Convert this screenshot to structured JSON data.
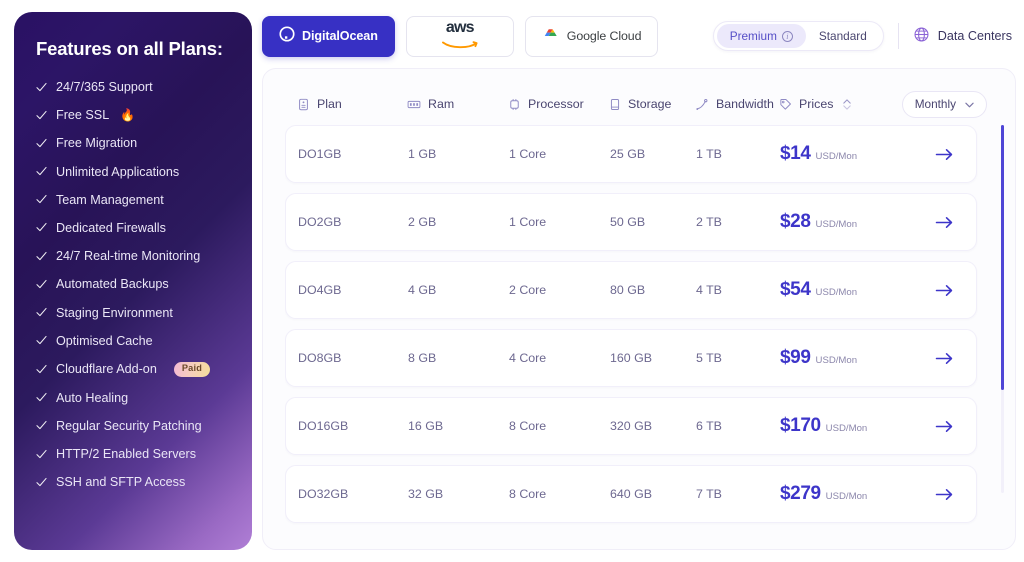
{
  "sidebar": {
    "title": "Features on all Plans:",
    "items": [
      {
        "label": "24/7/365 Support"
      },
      {
        "label": "Free SSL",
        "emoji": "🔥"
      },
      {
        "label": "Free Migration"
      },
      {
        "label": "Unlimited Applications"
      },
      {
        "label": "Team Management"
      },
      {
        "label": "Dedicated Firewalls"
      },
      {
        "label": "24/7 Real-time Monitoring"
      },
      {
        "label": "Automated Backups"
      },
      {
        "label": "Staging Environment"
      },
      {
        "label": "Optimised Cache"
      },
      {
        "label": "Cloudflare Add-on",
        "badge": "Paid"
      },
      {
        "label": "Auto Healing"
      },
      {
        "label": "Regular Security Patching"
      },
      {
        "label": "HTTP/2 Enabled Servers"
      },
      {
        "label": "SSH and SFTP Access"
      }
    ]
  },
  "topbar": {
    "providers": [
      {
        "id": "digitalocean",
        "label": "DigitalOcean",
        "active": true
      },
      {
        "id": "aws",
        "label": "aws",
        "active": false
      },
      {
        "id": "google-cloud",
        "label": "Google Cloud",
        "active": false
      }
    ],
    "tier_toggle": {
      "premium_label": "Premium",
      "standard_label": "Standard",
      "selected": "Premium"
    },
    "data_centers_label": "Data Centers"
  },
  "table": {
    "columns": [
      {
        "key": "plan",
        "label": "Plan",
        "icon": "plan-icon"
      },
      {
        "key": "ram",
        "label": "Ram",
        "icon": "ram-icon"
      },
      {
        "key": "processor",
        "label": "Processor",
        "icon": "processor-icon"
      },
      {
        "key": "storage",
        "label": "Storage",
        "icon": "storage-icon"
      },
      {
        "key": "bandwidth",
        "label": "Bandwidth",
        "icon": "bandwidth-icon"
      },
      {
        "key": "prices",
        "label": "Prices",
        "icon": "prices-icon",
        "sortable": true
      }
    ],
    "period_selector": {
      "value": "Monthly"
    },
    "price_unit": "USD/Mon",
    "currency_symbol": "$",
    "rows": [
      {
        "plan": "DO1GB",
        "ram": "1 GB",
        "processor": "1 Core",
        "storage": "25 GB",
        "bandwidth": "1 TB",
        "price": "14",
        "unit": "USD/Mon"
      },
      {
        "plan": "DO2GB",
        "ram": "2 GB",
        "processor": "1 Core",
        "storage": "50 GB",
        "bandwidth": "2 TB",
        "price": "28",
        "unit": "USD/Mon"
      },
      {
        "plan": "DO4GB",
        "ram": "4 GB",
        "processor": "2 Core",
        "storage": "80 GB",
        "bandwidth": "4 TB",
        "price": "54",
        "unit": "USD/Mon"
      },
      {
        "plan": "DO8GB",
        "ram": "8 GB",
        "processor": "4 Core",
        "storage": "160 GB",
        "bandwidth": "5 TB",
        "price": "99",
        "unit": "USD/Mon"
      },
      {
        "plan": "DO16GB",
        "ram": "16 GB",
        "processor": "8 Core",
        "storage": "320 GB",
        "bandwidth": "6 TB",
        "price": "170",
        "unit": "USD/Mon"
      },
      {
        "plan": "DO32GB",
        "ram": "32 GB",
        "processor": "8 Core",
        "storage": "640 GB",
        "bandwidth": "7 TB",
        "price": "279",
        "unit": "USD/Mon"
      }
    ]
  },
  "colors": {
    "accent": "#3d35c9",
    "tab_active_bg": "#3730c4",
    "sidebar_from": "#2a1164",
    "sidebar_to": "#b07fd6",
    "badge_text": "#6b4a2a"
  }
}
